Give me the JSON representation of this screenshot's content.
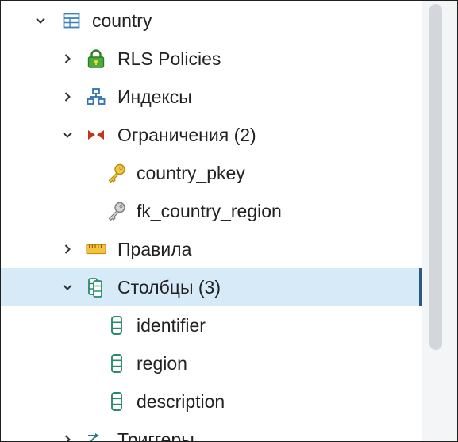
{
  "tree": {
    "nodes": [
      {
        "label": "country",
        "icon": "table-icon",
        "expanded": true
      },
      {
        "label": "RLS Policies",
        "icon": "lock-icon",
        "expanded": false
      },
      {
        "label": "Индексы",
        "icon": "index-icon",
        "expanded": false
      },
      {
        "label": "Ограничения",
        "count": "(2)",
        "icon": "constraint-icon",
        "expanded": true
      },
      {
        "label": "country_pkey",
        "icon": "primary-key-icon"
      },
      {
        "label": "fk_country_region",
        "icon": "foreign-key-icon"
      },
      {
        "label": "Правила",
        "icon": "rules-icon",
        "expanded": false
      },
      {
        "label": "Столбцы",
        "count": "(3)",
        "icon": "columns-icon",
        "expanded": true,
        "selected": true
      },
      {
        "label": "identifier",
        "icon": "column-icon"
      },
      {
        "label": "region",
        "icon": "column-icon"
      },
      {
        "label": "description",
        "icon": "column-icon"
      },
      {
        "label": "Триггеры",
        "icon": "trigger-icon",
        "expanded": false
      }
    ]
  },
  "colors": {
    "selected_background": "#d6eaf7",
    "selected_marker": "#2b5b84",
    "column_icon": "#2a8a68",
    "key_icon": "#e0b92a",
    "lock_icon": "#3a9a2e"
  }
}
